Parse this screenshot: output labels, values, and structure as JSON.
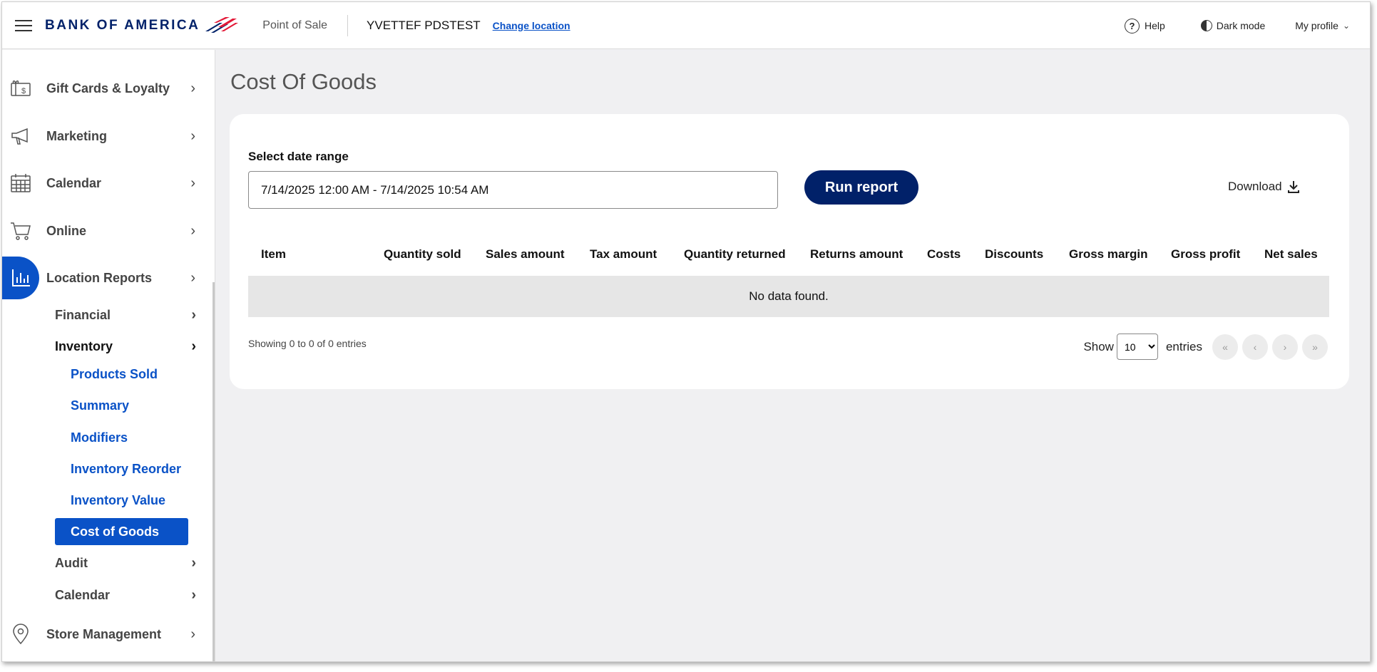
{
  "header": {
    "logo_text": "BANK OF AMERICA",
    "app_name": "Point of Sale",
    "location_name": "YVETTEF PDSTEST",
    "change_location": "Change location",
    "help": "Help",
    "dark_mode": "Dark mode",
    "my_profile": "My profile"
  },
  "sidebar": {
    "main_items": [
      {
        "label": "Gift Cards & Loyalty",
        "icon": "gift-card-icon"
      },
      {
        "label": "Marketing",
        "icon": "megaphone-icon"
      },
      {
        "label": "Calendar",
        "icon": "calendar-icon"
      },
      {
        "label": "Online",
        "icon": "cart-icon"
      },
      {
        "label": "Location Reports",
        "icon": "bar-chart-icon",
        "active": true
      },
      {
        "label": "Store Management",
        "icon": "location-pin-icon"
      }
    ],
    "report_sub_items": [
      "Financial",
      "Inventory",
      "Audit",
      "Calendar"
    ],
    "inventory_items": [
      "Products Sold",
      "Summary",
      "Modifiers",
      "Inventory Reorder",
      "Inventory Value",
      "Cost of Goods"
    ],
    "selected": "Cost of Goods"
  },
  "main": {
    "page_title": "Cost Of Goods",
    "date_range_label": "Select date range",
    "date_range_value": "7/14/2025 12:00 AM - 7/14/2025 10:54 AM",
    "run_report": "Run report",
    "download": "Download",
    "table": {
      "columns": [
        "Item",
        "Quantity sold",
        "Sales amount",
        "Tax amount",
        "Quantity returned",
        "Returns amount",
        "Costs",
        "Discounts",
        "Gross margin",
        "Gross profit",
        "Net sales"
      ],
      "empty_message": "No data found."
    },
    "showing": "Showing 0 to 0 of 0 entries",
    "show_label": "Show",
    "page_size": "10",
    "entries_label": "entries",
    "pager": {
      "first": "«",
      "prev": "‹",
      "next": "›",
      "last": "»"
    }
  },
  "colors": {
    "brand_navy": "#012169",
    "accent_blue": "#0a52c7",
    "brand_red": "#e31837"
  }
}
